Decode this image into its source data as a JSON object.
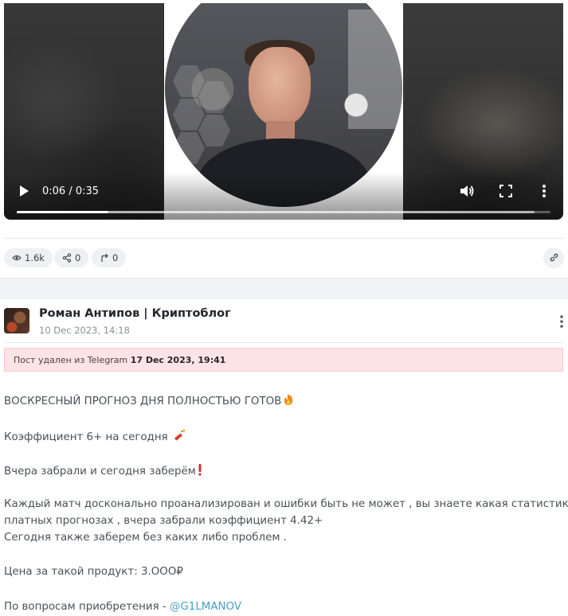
{
  "video": {
    "time_label": "0:06 / 0:35",
    "progress_fraction": 0.171,
    "buffered_fraction": 0.97
  },
  "stats": {
    "views": "1.6k",
    "shares": "0",
    "forwards": "0"
  },
  "post": {
    "author": "Роман Антипов | Криптоблог",
    "date": "10 Dec 2023, 14:18",
    "deleted_notice": {
      "prefix": "Пост удален из Telegram ",
      "date": "17 Dec 2023, 19:41"
    },
    "lines": {
      "l1": "ВОСКРЕСНЫЙ ПРОГНОЗ ДНЯ ПОЛНОСТЬЮ ГОТОВ",
      "l2": "Коэффициент 6+ на сегодня ",
      "l3": "Вчера забрали и сегодня заберём",
      "l4": "Каждый матч досконально проанализирован и ошибки быть не может , вы знаете какая статистика в",
      "l5": "платных прогнозах , вчера забрали коэффициент 4.42+",
      "l6": "Сегодня также заберем без каких либо проблем .",
      "l7": "Цена за такой продукт: 3.ООО₽",
      "l8_prefix": "По вопросам приобретения - ",
      "l8_link": "@G1LMANOV"
    }
  },
  "icons": {
    "views": "eye-icon",
    "shares": "share-nodes-icon",
    "forwards": "forward-arrow-icon",
    "link": "link-icon",
    "l1_emoji": "fire-icon",
    "l2_emoji": "dynamite-icon",
    "l3_emoji": "exclamation-icon"
  },
  "colors": {
    "link": "#4a9fbd",
    "deleted_bg": "#fce4e6",
    "pill_bg": "#eef0f3"
  }
}
